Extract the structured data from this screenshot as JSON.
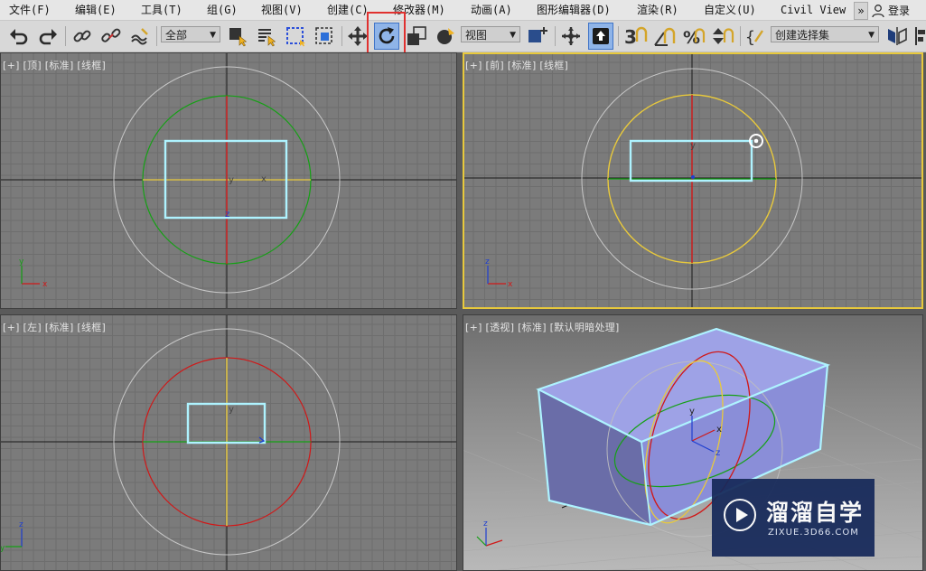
{
  "menu": {
    "items": [
      {
        "id": "file",
        "label": "文件(F)"
      },
      {
        "id": "edit",
        "label": "编辑(E)"
      },
      {
        "id": "tools",
        "label": "工具(T)"
      },
      {
        "id": "group",
        "label": "组(G)"
      },
      {
        "id": "views",
        "label": "视图(V)"
      },
      {
        "id": "create",
        "label": "创建(C)"
      },
      {
        "id": "modifiers",
        "label": "修改器(M)"
      },
      {
        "id": "animation",
        "label": "动画(A)"
      },
      {
        "id": "graph-editors",
        "label": "图形编辑器(D)"
      },
      {
        "id": "rendering",
        "label": "渲染(R)"
      },
      {
        "id": "customize",
        "label": "自定义(U)"
      },
      {
        "id": "civil-view",
        "label": "Civil View"
      }
    ],
    "more": "»",
    "login": "登录"
  },
  "toolbar": {
    "selection_filter": "全部",
    "ref_coord_system": "视图",
    "named_selection_set": "创建选择集",
    "active_tool": "select-and-rotate"
  },
  "viewports": {
    "top": {
      "label": "[+] [顶] [标准] [线框]"
    },
    "front": {
      "label": "[+] [前] [标准] [线框]"
    },
    "left": {
      "label": "[+] [左] [标准] [线框]"
    },
    "perspective": {
      "label": "[+] [透视] [标准] [默认明暗处理]"
    }
  },
  "axis_labels": {
    "x": "x",
    "y": "y",
    "z": "z"
  },
  "colors": {
    "selection": "#aef3ff",
    "active_viewport": "#e8c93c",
    "gizmo_x": "#d01818",
    "gizmo_y": "#15a015",
    "gizmo_z": "#1f3fd0",
    "gizmo_view": "#e8c93c",
    "box_face": "#8e92dd",
    "highlight": "#e0312f"
  },
  "watermark": {
    "title": "溜溜自学",
    "subtitle": "ZIXUE.3D66.COM"
  }
}
